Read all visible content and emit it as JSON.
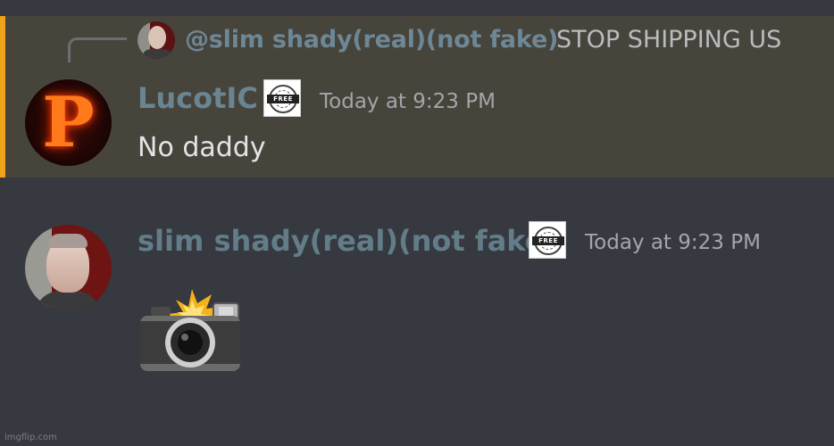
{
  "reply": {
    "mention": "@slim shady(real)(not fake)",
    "text": "STOP SHIPPING US"
  },
  "messages": [
    {
      "author": "LucotIC",
      "badge_text": "FREE",
      "timestamp": "Today at 9:23 PM",
      "text": "No daddy",
      "avatar_letter": "P"
    },
    {
      "author": "slim shady(real)(not fake)",
      "badge_text": "FREE",
      "timestamp": "Today at 9:23 PM",
      "emoji": "camera-with-flash"
    }
  ],
  "watermark": "imgflip.com",
  "colors": {
    "background": "#363940",
    "highlight": "#46443b",
    "accent": "#f0a218",
    "username": "#6a8592"
  }
}
